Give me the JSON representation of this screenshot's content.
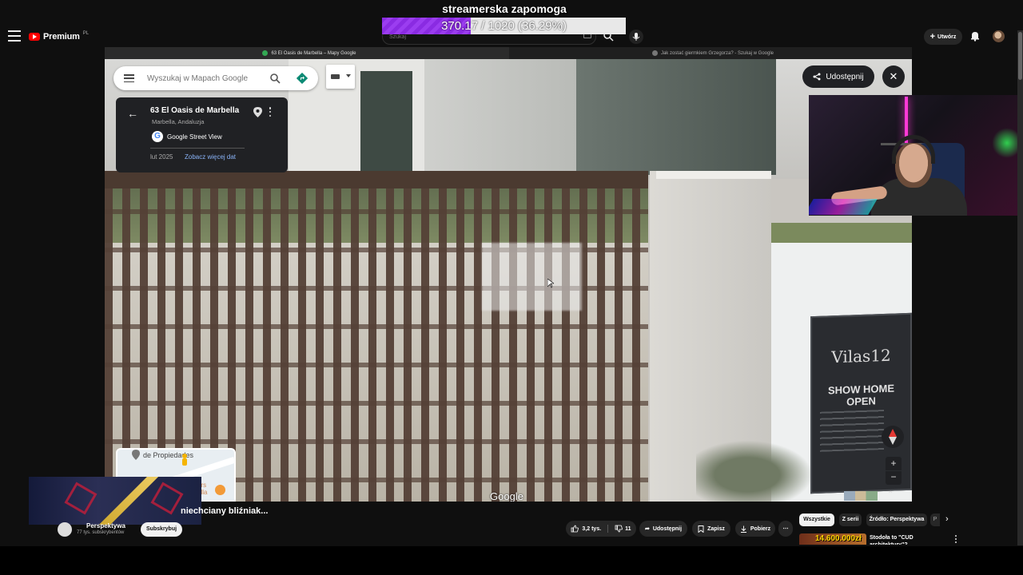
{
  "donation": {
    "title": "streamerska zapomoga",
    "progress_text": "370.17 / 1020 (36.29%)",
    "current": 370.17,
    "goal": 1020,
    "percent": 36.29
  },
  "youtube": {
    "logo_text": "Premium",
    "region": "PL",
    "search_placeholder": "Szukaj",
    "create_label": "Utwórz",
    "video_title": "niechciany bliźniak...",
    "channel_name": "Perspektywa",
    "channel_subs": "77 tys. subskrybentów",
    "subscribe_label": "Subskrybuj",
    "like_count": "3,2 tys.",
    "dislike_count": "11",
    "share_label": "Udostępnij",
    "save_label": "Zapisz",
    "download_label": "Pobierz",
    "chips": [
      "Wszystkie",
      "Z serii",
      "Źródło: Perspektywa",
      "P"
    ],
    "recommendation": {
      "thumb_text": "14.600.000zł",
      "title": "Stodoła to \"CUD architektury\"?"
    }
  },
  "browser": {
    "tabs": [
      {
        "label": "63 El Oasis de Marbella – Mapy Google",
        "active": true
      },
      {
        "label": "Jak zostać giermkiem Grzegorza? - Szukaj w Google",
        "active": false
      }
    ]
  },
  "maps": {
    "search_placeholder": "Wyszukaj w Mapach Google",
    "address_title": "63 El Oasis de Marbella",
    "address_sub": "Marbella, Andaluzja",
    "gsv_label": "Google Street View",
    "date": "lut 2025",
    "more_dates": "Zobacz więcej dat",
    "share_label": "Udostępnij",
    "google_watermark": "Google",
    "minimap_label": "de Propiedades",
    "minimap_label2": "ors\nella",
    "sign": {
      "logo": "Vilas12",
      "title": "SHOW HOME OPEN"
    }
  },
  "colors": {
    "accent_red": "#ff0000",
    "donation_purple": "#8a2be2",
    "maps_link": "#8ab4f8"
  }
}
